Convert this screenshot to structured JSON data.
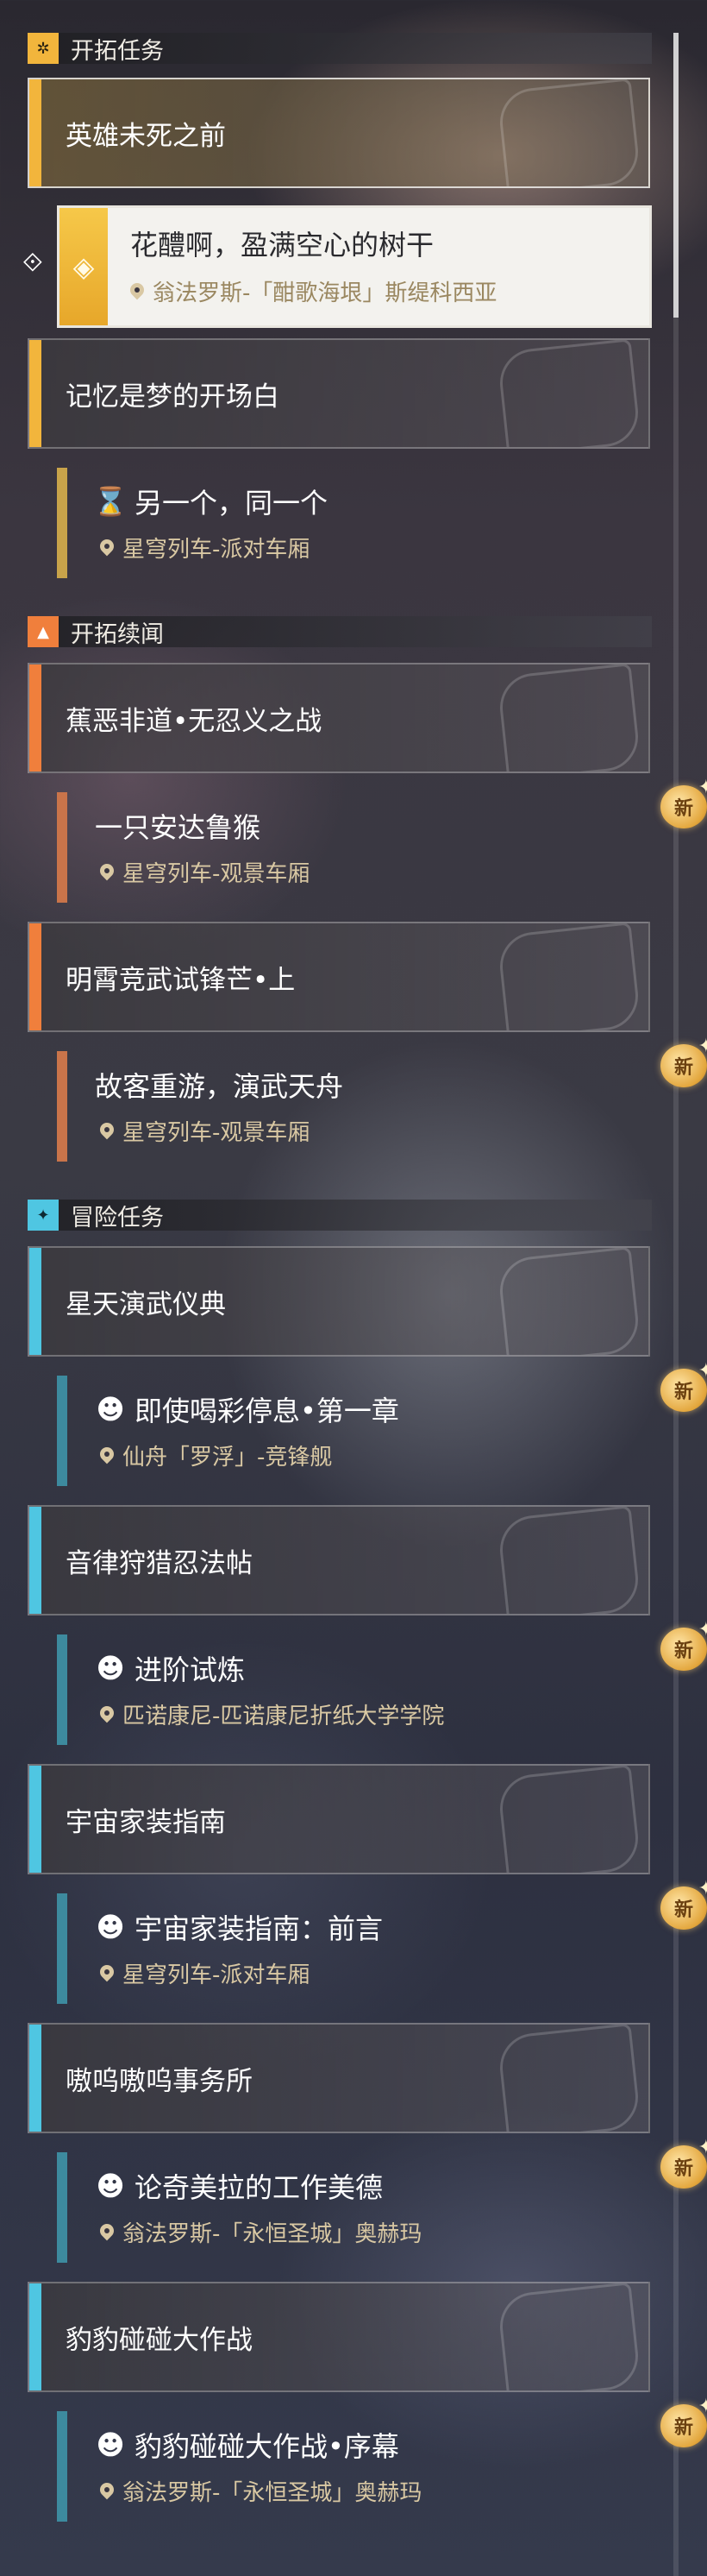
{
  "categories": [
    {
      "label": "开拓任务",
      "icon": "trailblaze-icon",
      "color": "#f2b53c"
    },
    {
      "label": "开拓续闻",
      "icon": "companion-icon",
      "color": "#f07f3c"
    },
    {
      "label": "冒险任务",
      "icon": "adventure-icon",
      "color": "#4fc6e2"
    }
  ],
  "trailblaze": {
    "m1": {
      "title": "英雄未死之前"
    },
    "selected": {
      "name": "花醴啊，盈满空心的树干",
      "location": "翁法罗斯-「酣歌海垠」斯缇科西亚"
    },
    "m2": {
      "title": "记忆是梦的开场白"
    },
    "s2": {
      "name": "另一个，同一个",
      "location": "星穹列车-派对车厢"
    }
  },
  "companion": {
    "m1": {
      "title": "蕉恶非道•无忍义之战"
    },
    "s1": {
      "name": "一只安达鲁猴",
      "location": "星穹列车-观景车厢",
      "badge": "新"
    },
    "m2": {
      "title": "明霄竞武试锋芒•上"
    },
    "s2": {
      "name": "故客重游，演武天舟",
      "location": "星穹列车-观景车厢",
      "badge": "新"
    }
  },
  "adventure": {
    "m1": {
      "title": "星天演武仪典"
    },
    "s1": {
      "name": "即使喝彩停息•第一章",
      "location": "仙舟「罗浮」-竞锋舰",
      "badge": "新"
    },
    "m2": {
      "title": "音律狩猎忍法帖"
    },
    "s2": {
      "name": "进阶试炼",
      "location": "匹诺康尼-匹诺康尼折纸大学学院",
      "badge": "新"
    },
    "m3": {
      "title": "宇宙家装指南"
    },
    "s3": {
      "name": "宇宙家装指南：前言",
      "location": "星穹列车-派对车厢",
      "badge": "新"
    },
    "m4": {
      "title": "嗷呜嗷呜事务所"
    },
    "s4": {
      "name": "论奇美拉的工作美德",
      "location": "翁法罗斯-「永恒圣城」奥赫玛",
      "badge": "新"
    },
    "m5": {
      "title": "豹豹碰碰大作战"
    },
    "s5": {
      "name": "豹豹碰碰大作战•序幕",
      "location": "翁法罗斯-「永恒圣城」奥赫玛",
      "badge": "新"
    }
  }
}
